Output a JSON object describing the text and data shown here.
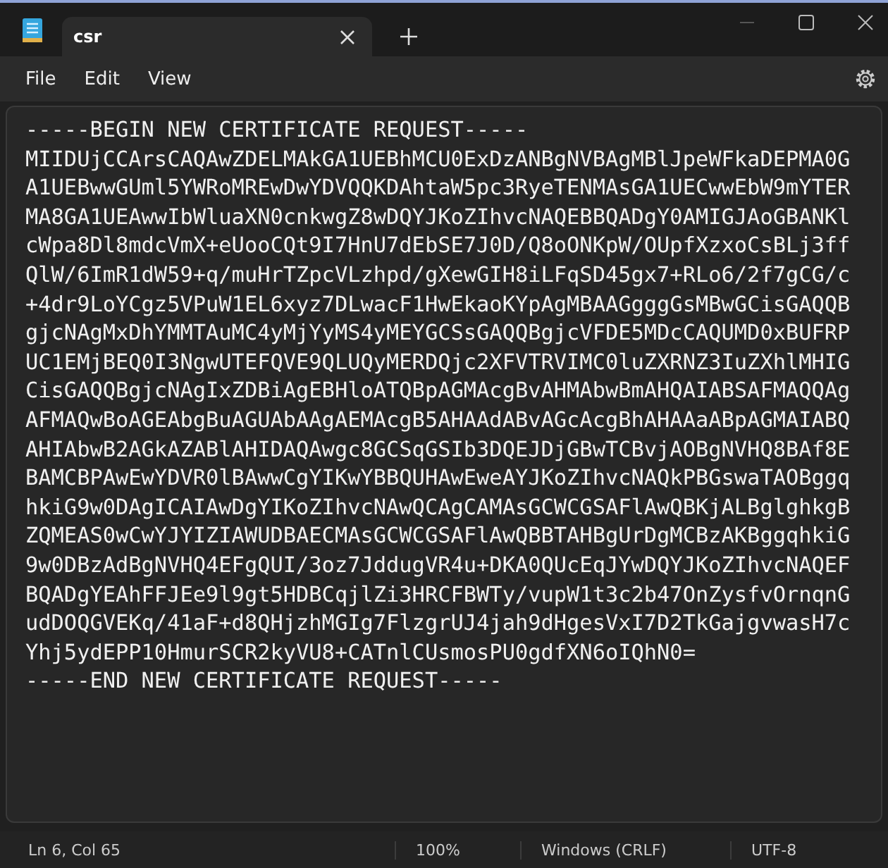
{
  "tabs": [
    {
      "label": "csr",
      "selected": true
    }
  ],
  "menu": [
    "File",
    "Edit",
    "View"
  ],
  "editor": {
    "lines": [
      "-----BEGIN NEW CERTIFICATE REQUEST-----",
      "MIIDUjCCArsCAQAwZDELMAkGA1UEBhMCU0ExDzANBgNVBAgMBlJpeWFkaDEPMA0G",
      "A1UEBwwGUml5YWRoMREwDwYDVQQKDAhtaW5pc3RyeTENMAsGA1UECwwEbW9mYTER",
      "MA8GA1UEAwwIbWluaXN0cnkwgZ8wDQYJKoZIhvcNAQEBBQADgY0AMIGJAoGBANKl",
      "cWpa8Dl8mdcVmX+eUooCQt9I7HnU7dEbSE7J0D/Q8oONKpW/OUpfXzxoCsBLj3ff",
      "QlW/6ImR1dW59+q/muHrTZpcVLzhpd/gXewGIH8iLFqSD45gx7+RLo6/2f7gCG/c",
      "+4dr9LoYCgz5VPuW1EL6xyz7DLwacF1HwEkaoKYpAgMBAAGgggGsMBwGCisGAQQB",
      "gjcNAgMxDhYMMTAuMC4yMjYyMS4yMEYGCSsGAQQBgjcVFDE5MDcCAQUMD0xBUFRP",
      "UC1EMjBEQ0I3NgwUTEFQVE9QLUQyMERDQjc2XFVTRVIMC0luZXRNZ3IuZXhlMHIG",
      "CisGAQQBgjcNAgIxZDBiAgEBHloATQBpAGMAcgBvAHMAbwBmAHQAIABSAFMAQQAg",
      "AFMAQwBoAGEAbgBuAGUAbAAgAEMAcgB5AHAAdABvAGcAcgBhAHAAaABpAGMAIABQ",
      "AHIAbwB2AGkAZABlAHIDAQAwgc8GCSqGSIb3DQEJDjGBwTCBvjAOBgNVHQ8BAf8E",
      "BAMCBPAwEwYDVR0lBAwwCgYIKwYBBQUHAwEweAYJKoZIhvcNAQkPBGswaTAOBggq",
      "hkiG9w0DAgICAIAwDgYIKoZIhvcNAwQCAgCAMAsGCWCGSAFlAwQBKjALBglghkgB",
      "ZQMEAS0wCwYJYIZIAWUDBAECMAsGCWCGSAFlAwQBBTAHBgUrDgMCBzAKBggqhkiG",
      "9w0DBzAdBgNVHQ4EFgQUI/3oz7JddugVR4u+DKA0QUcEqJYwDQYJKoZIhvcNAQEF",
      "BQADgYEAhFFJEe9l9gt5HDBCqjlZi3HRCFBWTy/vupW1t3c2b47OnZysfvOrnqnG",
      "udDOQGVEKq/41aF+d8QHjzhMGIg7FlzgrUJ4jah9dHgesVxI7D2TkGajgvwasH7c",
      "Yhj5ydEPP10HmurSCR2kyVU8+CATnlCUsmosPU0gdfXN6oIQhN0=",
      "-----END NEW CERTIFICATE REQUEST-----"
    ]
  },
  "status_bar": [
    "Ln 6, Col 65",
    "100%",
    "Windows (CRLF)",
    "UTF-8"
  ]
}
